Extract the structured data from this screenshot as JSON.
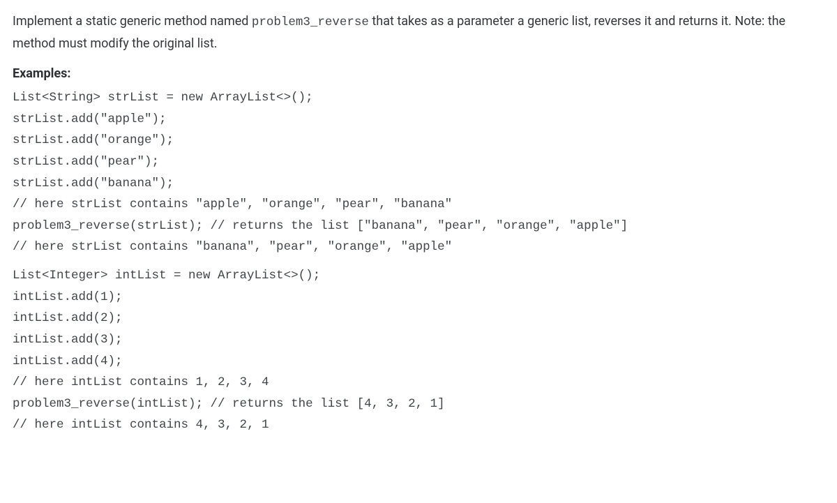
{
  "intro": {
    "prefix": "Implement a static generic method named ",
    "method_name": "problem3_reverse",
    "suffix": " that takes as a parameter a generic list, reverses it and returns it. Note: the method must modify the original list."
  },
  "examples_label": "Examples:",
  "code_block_1": "List<String> strList = new ArrayList<>();\nstrList.add(\"apple\");\nstrList.add(\"orange\");\nstrList.add(\"pear\");\nstrList.add(\"banana\");\n// here strList contains \"apple\", \"orange\", \"pear\", \"banana\"\nproblem3_reverse(strList); // returns the list [\"banana\", \"pear\", \"orange\", \"apple\"]\n// here strList contains \"banana\", \"pear\", \"orange\", \"apple\"",
  "code_block_2": "List<Integer> intList = new ArrayList<>();\nintList.add(1);\nintList.add(2);\nintList.add(3);\nintList.add(4);\n// here intList contains 1, 2, 3, 4\nproblem3_reverse(intList); // returns the list [4, 3, 2, 1]\n// here intList contains 4, 3, 2, 1"
}
